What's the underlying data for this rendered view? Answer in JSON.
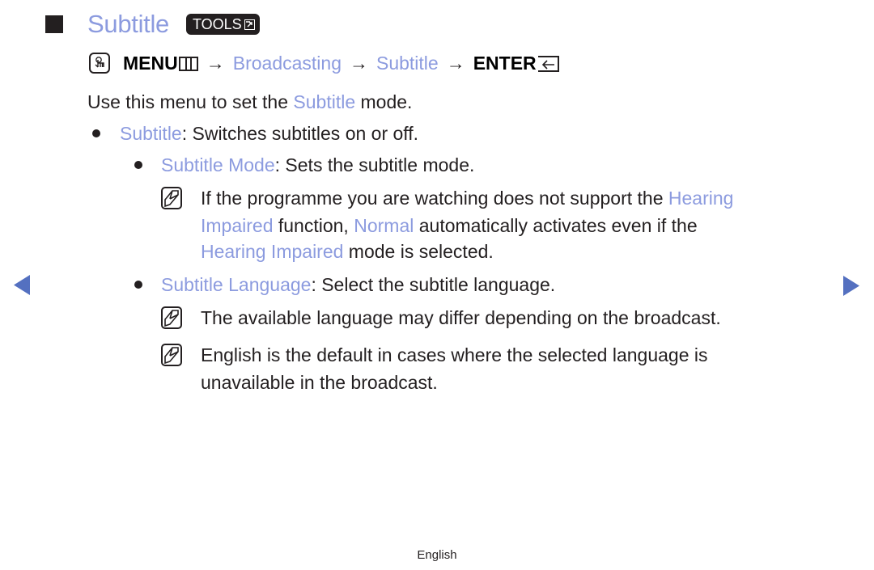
{
  "title": {
    "text": "Subtitle",
    "tools_badge": "TOOLS",
    "tools_icon": "tools-arrow-icon"
  },
  "menu_path": {
    "start_icon": "om-remote-icon",
    "menu_label": "MENU",
    "menu_icon": "menu-grid-icon",
    "arrow": "→",
    "step1": "Broadcasting",
    "step2": "Subtitle",
    "enter_label": "ENTER",
    "enter_icon": "enter-return-icon"
  },
  "intro": {
    "prefix": "Use this menu to set the ",
    "highlight": "Subtitle",
    "suffix": " mode."
  },
  "items": [
    {
      "term": "Subtitle",
      "desc": ": Switches subtitles on or off."
    },
    {
      "term": "Subtitle Mode",
      "desc": ": Sets the subtitle mode.",
      "note": {
        "line1_prefix": "If the programme you are watching does not support the ",
        "line1_highlight": "Hearing",
        "line2_highlight1": "Impaired",
        "line2_mid": " function, ",
        "line2_highlight2": "Normal",
        "line2_suffix": " automatically activates even if the",
        "line3_highlight": "Hearing Impaired",
        "line3_suffix": " mode is selected."
      }
    },
    {
      "term": "Subtitle Language",
      "desc": ": Select the subtitle language.",
      "notes": [
        {
          "line1": "The available language may differ depending on the broadcast."
        },
        {
          "line1": "English is the default in cases where the selected language is",
          "line2": "unavailable in the broadcast."
        }
      ]
    }
  ],
  "nav": {
    "prev_icon": "previous-page-icon",
    "next_icon": "next-page-icon"
  },
  "footer": {
    "language": "English"
  },
  "colors": {
    "highlight": "#8c9bdf",
    "text": "#231f20",
    "nav_arrow": "#5470c0"
  }
}
